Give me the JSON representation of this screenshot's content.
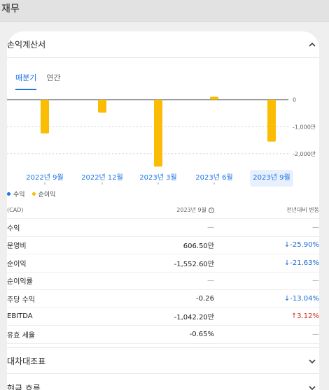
{
  "page_title": "재무",
  "income_section": {
    "title": "손익계산서"
  },
  "tabs": [
    {
      "label": "매분기",
      "active": true
    },
    {
      "label": "연간",
      "active": false
    }
  ],
  "chart_data": {
    "type": "bar",
    "categories": [
      "2022년 9월",
      "2022년 12월",
      "2023년 3월",
      "2023년 6월",
      "2023년 9월"
    ],
    "selected_category": "2023년 9월",
    "series": [
      {
        "name": "수익",
        "color": "#1a73e8",
        "values": [
          0,
          0,
          0,
          0,
          0
        ]
      },
      {
        "name": "순이익",
        "color": "#fbbc04",
        "values": [
          -1250,
          -480,
          -2480,
          110,
          -1552.6
        ]
      }
    ],
    "y_ticks": [
      {
        "value": 0,
        "label": "0"
      },
      {
        "value": -1000,
        "label": "-1,000만"
      },
      {
        "value": -2000,
        "label": "-2,000만"
      }
    ],
    "ylim": [
      -2600,
      200
    ]
  },
  "legend": [
    {
      "label": "수익",
      "color": "#1a73e8"
    },
    {
      "label": "순이익",
      "color": "#fbbc04"
    }
  ],
  "table": {
    "header": {
      "currency": "(CAD)",
      "period": "2023년 9월",
      "change": "전년대비 변동"
    },
    "rows": [
      {
        "label": "수익",
        "value": "—",
        "change": "—",
        "trend": "none"
      },
      {
        "label": "운영비",
        "value": "606.50만",
        "change": "↓-25.90%",
        "trend": "down"
      },
      {
        "label": "순이익",
        "value": "-1,552.60만",
        "change": "↓-21.63%",
        "trend": "down"
      },
      {
        "label": "순이익률",
        "value": "—",
        "change": "—",
        "trend": "none"
      },
      {
        "label": "주당 수익",
        "value": "-0.26",
        "change": "↓-13.04%",
        "trend": "down"
      },
      {
        "label": "EBITDA",
        "value": "-1,042.20만",
        "change": "↑3.12%",
        "trend": "up"
      },
      {
        "label": "유효 세율",
        "value": "-0.65%",
        "change": "—",
        "trend": "none"
      }
    ]
  },
  "sections": [
    {
      "title": "대차대조표"
    },
    {
      "title": "현금 흐름"
    }
  ]
}
